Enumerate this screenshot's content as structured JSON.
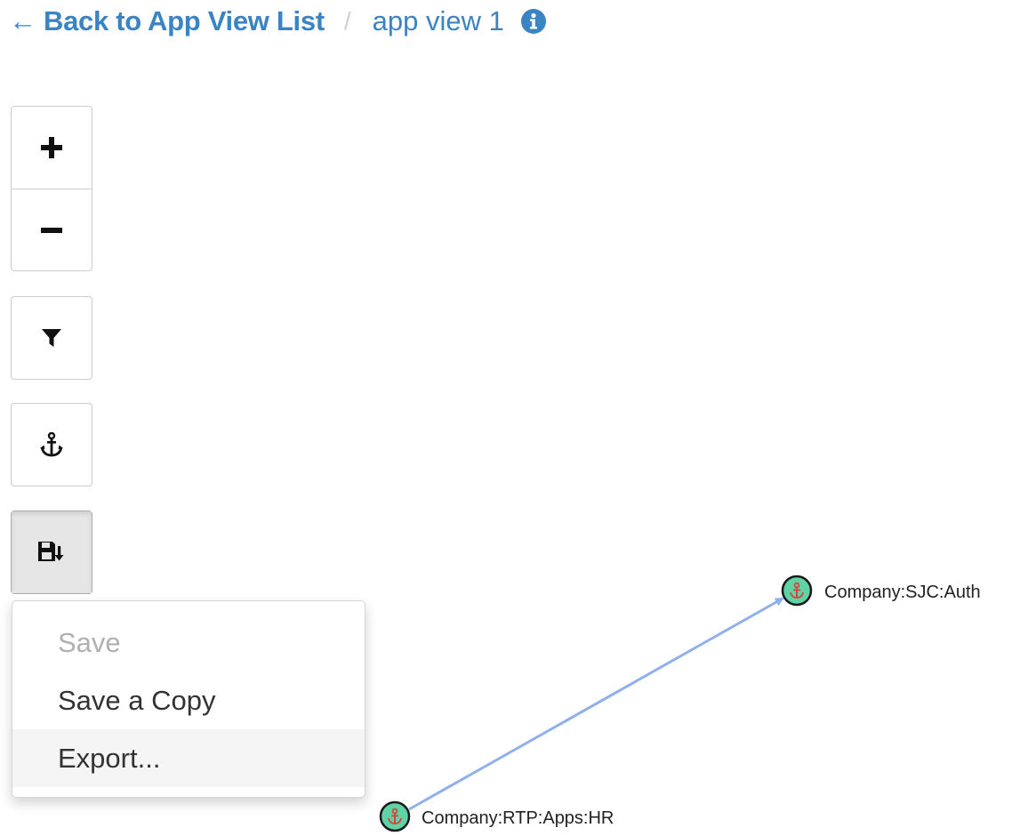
{
  "breadcrumb": {
    "back_label": "← Back to App View List",
    "separator": "/",
    "current_label": "app view 1",
    "info_icon": "info-circle-icon"
  },
  "toolbar": {
    "zoom_in_icon": "plus-icon",
    "zoom_out_icon": "minus-icon",
    "filter_icon": "filter-icon",
    "anchor_icon": "anchor-icon",
    "save_icon": "save-download-icon"
  },
  "save_menu": {
    "items": [
      {
        "label": "Save",
        "disabled": true
      },
      {
        "label": "Save a Copy",
        "disabled": false
      },
      {
        "label": "Export...",
        "disabled": false,
        "hovered": true
      }
    ]
  },
  "graph": {
    "nodes": [
      {
        "label": "Company:SJC:Auth",
        "icon": "anchor-icon"
      },
      {
        "label": "Company:RTP:Apps:HR",
        "icon": "anchor-icon"
      }
    ],
    "edge": {
      "from": "Company:RTP:Apps:HR",
      "to": "Company:SJC:Auth",
      "color": "#8fb0ee"
    },
    "node_fill": "#5fd3a6",
    "anchor_color": "#d9443a"
  },
  "colors": {
    "link": "#3a84c4",
    "separator": "#cfcfcf",
    "border": "#cccccc"
  }
}
